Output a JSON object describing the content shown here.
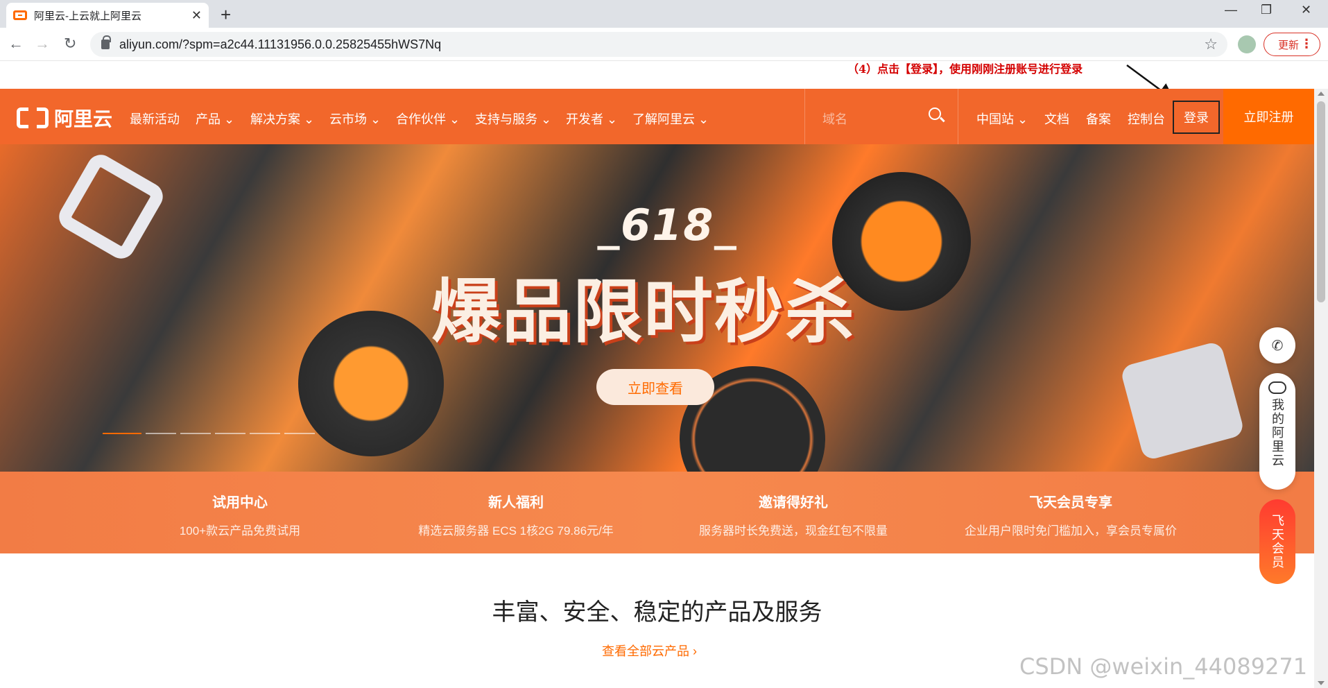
{
  "browser": {
    "tab_title": "阿里云-上云就上阿里云",
    "tab_close": "✕",
    "new_tab": "+",
    "url": "aliyun.com/?spm=a2c44.11131956.0.0.25825455hWS7Nq",
    "update_label": "更新",
    "menu_dots": "⋮",
    "window_minimize": "—",
    "window_restore": "❐",
    "window_close": "✕",
    "back": "←",
    "forward": "→",
    "reload": "↻",
    "star": "☆"
  },
  "annotation": {
    "text": "（4）点击【登录】，使用刚刚注册账号进行登录"
  },
  "site_nav": {
    "logo_text": "阿里云",
    "items": [
      {
        "label": "最新活动"
      },
      {
        "label": "产品 ⌄"
      },
      {
        "label": "解决方案 ⌄"
      },
      {
        "label": "云市场 ⌄"
      },
      {
        "label": "合作伙伴 ⌄"
      },
      {
        "label": "支持与服务 ⌄"
      },
      {
        "label": "开发者 ⌄"
      },
      {
        "label": "了解阿里云 ⌄"
      }
    ],
    "search_placeholder": "域名",
    "right_items": [
      {
        "label": "中国站 ⌄"
      },
      {
        "label": "文档"
      },
      {
        "label": "备案"
      },
      {
        "label": "控制台"
      }
    ],
    "login_label": "登录",
    "register_label": "立即注册",
    "brand_color": "#ff6a00"
  },
  "banner": {
    "subtitle": "_618_",
    "title": "爆品限时秒杀",
    "cta_label": "立即查看",
    "slide_count": 6,
    "active_slide": 1
  },
  "benefits": [
    {
      "title": "试用中心",
      "desc": "100+款云产品免费试用"
    },
    {
      "title": "新人福利",
      "desc": "精选云服务器 ECS 1核2G 79.86元/年"
    },
    {
      "title": "邀请得好礼",
      "desc": "服务器时长免费送，现金红包不限量"
    },
    {
      "title": "飞天会员专享",
      "desc": "企业用户限时免门槛加入，享会员专属价"
    }
  ],
  "main": {
    "section_title": "丰富、安全、稳定的产品及服务",
    "view_all_label": "查看全部云产品 ›"
  },
  "side_widgets": {
    "phone_icon": "✆",
    "my_aliyun": "我的阿里云",
    "vip": "飞天会员"
  },
  "watermark": "CSDN @weixin_44089271"
}
